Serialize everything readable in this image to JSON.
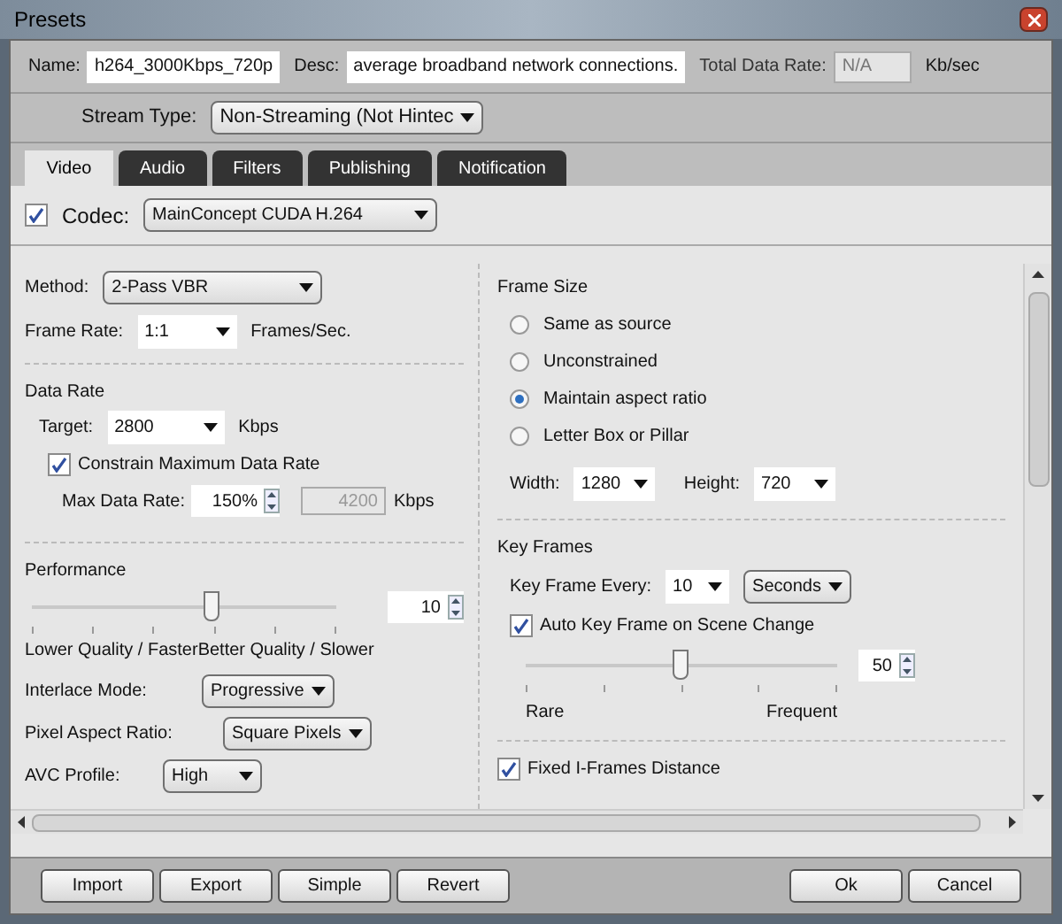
{
  "window": {
    "title": "Presets"
  },
  "header": {
    "name": {
      "label": "Name:",
      "value": "h264_3000Kbps_720p"
    },
    "desc": {
      "label": "Desc:",
      "value": "average broadband network connections."
    },
    "total": {
      "label": "Total Data Rate:",
      "value": "N/A",
      "disabled": true,
      "unit": "Kb/sec"
    },
    "stream_type": {
      "label": "Stream Type:",
      "value": "Non-Streaming (Not Hintec"
    }
  },
  "tabs": [
    {
      "label": "Video",
      "selected": true
    },
    {
      "label": "Audio",
      "selected": false
    },
    {
      "label": "Filters",
      "selected": false
    },
    {
      "label": "Publishing",
      "selected": false
    },
    {
      "label": "Notification",
      "selected": false
    }
  ],
  "codec": {
    "label": "Codec:",
    "checked": true,
    "value": "MainConcept CUDA H.264"
  },
  "left": {
    "method": {
      "label": "Method:",
      "value": "2-Pass VBR"
    },
    "frame_rate": {
      "label": "Frame Rate:",
      "value": "1:1",
      "unit": "Frames/Sec."
    },
    "data_rate": {
      "title": "Data Rate",
      "target": {
        "label": "Target:",
        "value": "2800",
        "unit": "Kbps"
      },
      "constrain": {
        "label": "Constrain Maximum Data Rate",
        "checked": true
      },
      "max": {
        "label": "Max Data Rate:",
        "value": "150%",
        "computed": "4200",
        "disabled": true,
        "unit": "Kbps"
      }
    },
    "performance": {
      "title": "Performance",
      "level": 0.59,
      "value": "10",
      "low_label": "Lower Quality / Faster",
      "high_label": "Better Quality / Slower"
    },
    "interlace": {
      "label": "Interlace Mode:",
      "value": "Progressive"
    },
    "pixel_aspect": {
      "label": "Pixel Aspect Ratio:",
      "value": "Square Pixels"
    },
    "avc_profile": {
      "label": "AVC Profile:",
      "value": "High"
    }
  },
  "right": {
    "frame_size": {
      "title": "Frame Size",
      "options": [
        {
          "label": "Same as source",
          "selected": false
        },
        {
          "label": "Unconstrained",
          "selected": false
        },
        {
          "label": "Maintain aspect ratio",
          "selected": true
        },
        {
          "label": "Letter Box or Pillar",
          "selected": false
        }
      ],
      "width": {
        "label": "Width:",
        "value": "1280"
      },
      "height": {
        "label": "Height:",
        "value": "720"
      }
    },
    "key_frames": {
      "title": "Key Frames",
      "every": {
        "label": "Key Frame Every:",
        "value": "10",
        "unit": "Seconds"
      },
      "auto": {
        "label": "Auto Key Frame on Scene Change",
        "checked": true
      },
      "level": 0.5,
      "value": "50",
      "low_label": "Rare",
      "high_label": "Frequent"
    },
    "fixed_iframes": {
      "label": "Fixed I-Frames Distance",
      "checked": true
    }
  },
  "buttons_left": [
    "Import",
    "Export",
    "Simple",
    "Revert"
  ],
  "buttons_right": [
    "Ok",
    "Cancel"
  ]
}
